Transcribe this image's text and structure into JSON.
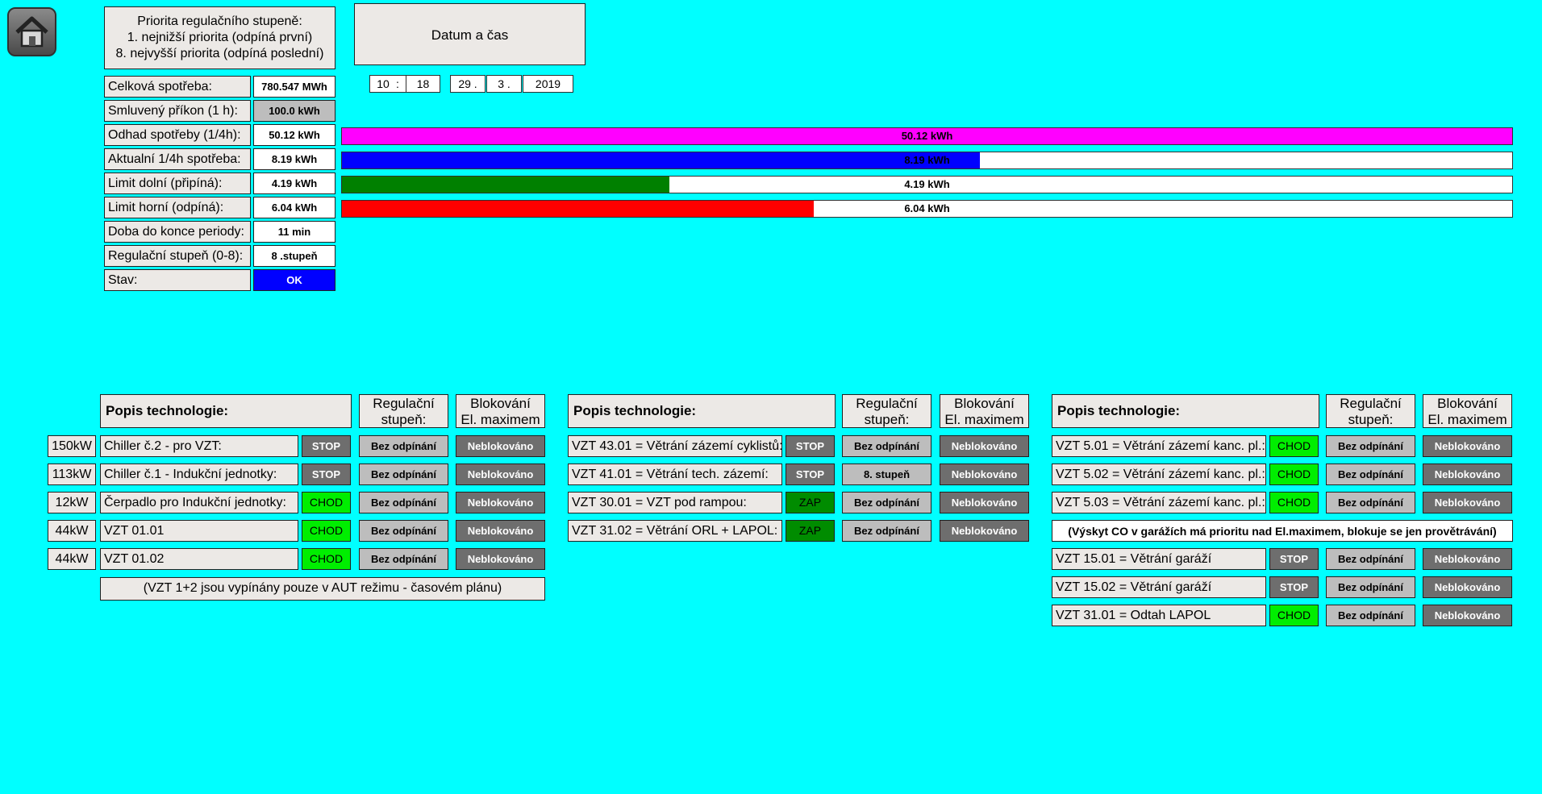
{
  "priority_box": {
    "line1": "Priorita regulačního stupeně:",
    "line2": "1. nejnižší priorita (odpíná první)",
    "line3": "8. nejvyšší priorita (odpíná poslední)"
  },
  "datetime_box": {
    "title": "Datum a čas"
  },
  "datetime": {
    "hour": "10",
    "sep1": ":",
    "minute": "18",
    "day": "29 .",
    "month": "3 .",
    "year": "2019"
  },
  "stats": [
    {
      "label": "Celková spotřeba:",
      "value": "780.547 MWh",
      "style": "white"
    },
    {
      "label": "Smluvený příkon (1 h):",
      "value": "100.0 kWh",
      "style": "grey"
    },
    {
      "label": "Odhad spotřeby (1/4h):",
      "value": "50.12 kWh",
      "style": "white"
    },
    {
      "label": "Aktualní 1/4h spotřeba:",
      "value": "8.19 kWh",
      "style": "white"
    },
    {
      "label": "Limit dolní (připíná):",
      "value": "4.19 kWh",
      "style": "white"
    },
    {
      "label": "Limit horní (odpíná):",
      "value": "6.04 kWh",
      "style": "white"
    },
    {
      "label": "Doba do konce periody:",
      "value": "11 min",
      "style": "white"
    },
    {
      "label": "Regulační stupeň (0-8):",
      "value": "8 .stupeň",
      "style": "white"
    },
    {
      "label": "Stav:",
      "value": "OK",
      "style": "blue"
    }
  ],
  "bars": [
    {
      "text": "50.12 kWh",
      "color": "#ff00ff",
      "fraction": 1.0
    },
    {
      "text": "8.19 kWh",
      "color": "#0000ff",
      "fraction": 0.545
    },
    {
      "text": "4.19 kWh",
      "color": "#008000",
      "fraction": 0.28
    },
    {
      "text": "6.04 kWh",
      "color": "#ff0000",
      "fraction": 0.403
    }
  ],
  "headers": {
    "popis": "Popis technologie:",
    "reg1": "Regulační",
    "reg2": "stupeň:",
    "blk1": "Blokování",
    "blk2": "El. maximem"
  },
  "group1": {
    "rows": [
      {
        "kw": "150kW",
        "label": "Chiller č.2 - pro VZT:",
        "status": "STOP",
        "reg": "Bez odpínání",
        "blk": "Neblokováno"
      },
      {
        "kw": "113kW",
        "label": "Chiller č.1 - Indukční jednotky:",
        "status": "STOP",
        "reg": "Bez odpínání",
        "blk": "Neblokováno"
      },
      {
        "kw": "12kW",
        "label": "Čerpadlo pro Indukční jednotky:",
        "status": "CHOD",
        "reg": "Bez odpínání",
        "blk": "Neblokováno"
      },
      {
        "kw": "44kW",
        "label": "VZT 01.01",
        "status": "CHOD",
        "reg": "Bez odpínání",
        "blk": "Neblokováno"
      },
      {
        "kw": "44kW",
        "label": "VZT 01.02",
        "status": "CHOD",
        "reg": "Bez odpínání",
        "blk": "Neblokováno"
      }
    ],
    "note": "(VZT 1+2 jsou vypínány pouze v AUT režimu - časovém plánu)"
  },
  "group2": {
    "rows": [
      {
        "label": "VZT 43.01 = Větrání zázemí cyklistů:",
        "status": "STOP",
        "reg": "Bez odpínání",
        "blk": "Neblokováno"
      },
      {
        "label": "VZT 41.01 = Větrání tech. zázemí:",
        "status": "STOP",
        "reg": "8. stupeň",
        "blk": "Neblokováno"
      },
      {
        "label": "VZT 30.01 = VZT pod rampou:",
        "status": "ZAP",
        "reg": "Bez odpínání",
        "blk": "Neblokováno"
      },
      {
        "label": "VZT 31.02 = Větrání ORL + LAPOL:",
        "status": "ZAP",
        "reg": "Bez odpínání",
        "blk": "Neblokováno"
      }
    ]
  },
  "group3": {
    "rows_top": [
      {
        "label": "VZT 5.01 = Větrání zázemí kanc. pl.:",
        "status": "CHOD",
        "reg": "Bez odpínání",
        "blk": "Neblokováno"
      },
      {
        "label": "VZT 5.02 = Větrání zázemí kanc. pl.:",
        "status": "CHOD",
        "reg": "Bez odpínání",
        "blk": "Neblokováno"
      },
      {
        "label": "VZT 5.03 = Větrání zázemí kanc. pl.:",
        "status": "CHOD",
        "reg": "Bez odpínání",
        "blk": "Neblokováno"
      }
    ],
    "note": "(Výskyt CO v garážích má prioritu nad El.maximem, blokuje se jen provětrávání)",
    "rows_bottom": [
      {
        "label": "VZT 15.01 = Větrání garáží",
        "status": "STOP",
        "reg": "Bez odpínání",
        "blk": "Neblokováno"
      },
      {
        "label": "VZT 15.02 = Větrání garáží",
        "status": "STOP",
        "reg": "Bez odpínání",
        "blk": "Neblokováno"
      },
      {
        "label": "VZT 31.01 = Odtah LAPOL",
        "status": "CHOD",
        "reg": "Bez odpínání",
        "blk": "Neblokováno"
      }
    ]
  }
}
